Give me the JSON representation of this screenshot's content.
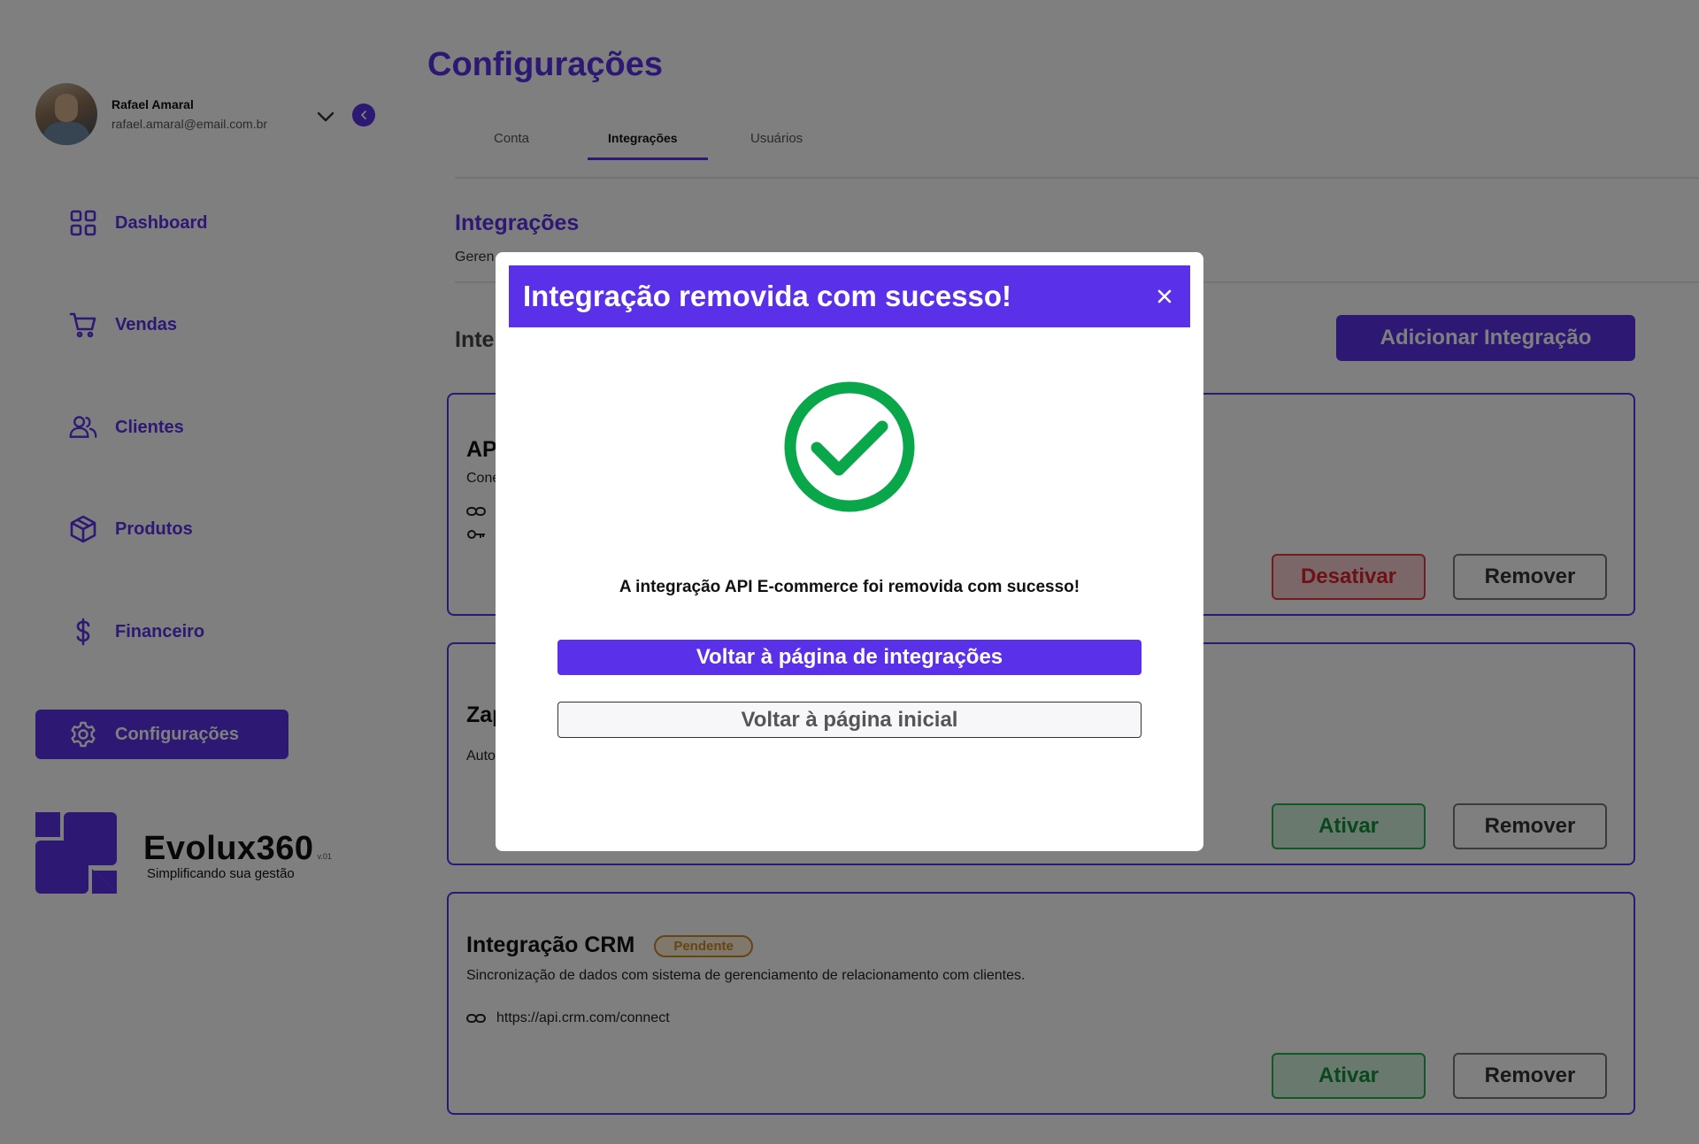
{
  "user": {
    "name": "Rafael Amaral",
    "email": "rafael.amaral@email.com.br"
  },
  "nav": [
    {
      "label": "Dashboard",
      "icon": "grid-icon"
    },
    {
      "label": "Vendas",
      "icon": "cart-icon"
    },
    {
      "label": "Clientes",
      "icon": "users-icon"
    },
    {
      "label": "Produtos",
      "icon": "box-icon"
    },
    {
      "label": "Financeiro",
      "icon": "dollar-icon"
    },
    {
      "label": "Configurações",
      "icon": "gear-icon",
      "active": true
    }
  ],
  "brand": {
    "name": "Evolux360",
    "version": "v.01",
    "tagline": "Simplificando sua gestão"
  },
  "page": {
    "title": "Configurações"
  },
  "tabs": [
    {
      "label": "Conta"
    },
    {
      "label": "Integrações",
      "active": true
    },
    {
      "label": "Usuários"
    }
  ],
  "section": {
    "title": "Integrações",
    "subtitle": "Geren",
    "list_heading": "Inte",
    "add_button": "Adicionar Integração"
  },
  "cards": [
    {
      "title": "AP",
      "description": "Cone",
      "primary_action": "Desativar",
      "secondary_action": "Remover"
    },
    {
      "title": "Zap",
      "description": "Auto",
      "primary_action": "Ativar",
      "secondary_action": "Remover"
    },
    {
      "title": "Integração CRM",
      "badge": "Pendente",
      "description": "Sincronização de dados com sistema de gerenciamento de relacionamento com clientes.",
      "url": "https://api.crm.com/connect",
      "primary_action": "Ativar",
      "secondary_action": "Remover"
    }
  ],
  "modal": {
    "title": "Integração removida com sucesso!",
    "message": "A integração API E-commerce foi removida com sucesso!",
    "primary_button": "Voltar à página de integrações",
    "secondary_button": "Voltar à página inicial"
  },
  "colors": {
    "primary": "#5a31e8",
    "success": "#0aa64a",
    "danger": "#e23a3f",
    "warning": "#c98a2a"
  }
}
